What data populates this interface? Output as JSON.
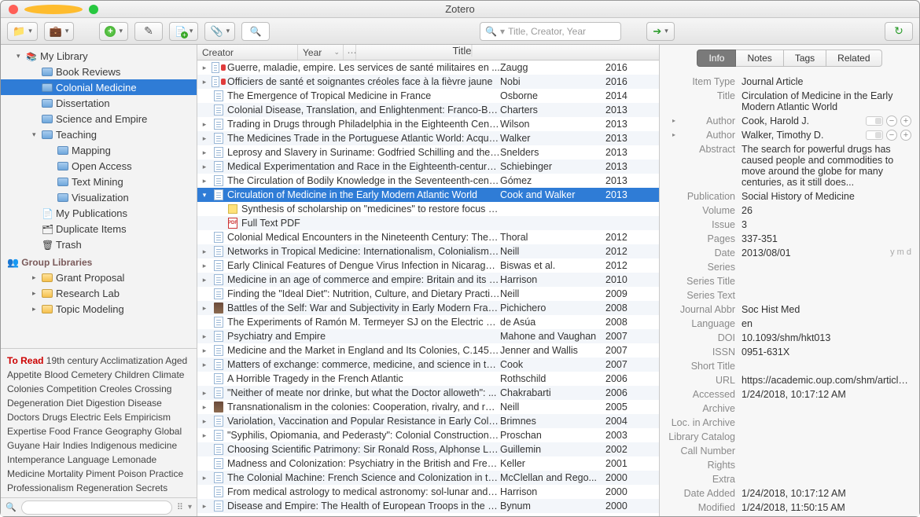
{
  "window": {
    "title": "Zotero"
  },
  "toolbar": {
    "search_placeholder": "Title, Creator, Year"
  },
  "sidebar": {
    "library_label": "My Library",
    "items": [
      {
        "label": "Book Reviews"
      },
      {
        "label": "Colonial Medicine",
        "selected": true
      },
      {
        "label": "Dissertation"
      },
      {
        "label": "Science and Empire"
      },
      {
        "label": "Teaching",
        "expanded": true,
        "children": [
          {
            "label": "Mapping"
          },
          {
            "label": "Open Access"
          },
          {
            "label": "Text Mining"
          },
          {
            "label": "Visualization"
          }
        ]
      }
    ],
    "my_publications": "My Publications",
    "duplicate": "Duplicate Items",
    "trash": "Trash",
    "group_header": "Group Libraries",
    "groups": [
      {
        "label": "Grant Proposal"
      },
      {
        "label": "Research Lab"
      },
      {
        "label": "Topic Modeling"
      }
    ]
  },
  "tags": [
    "To Read",
    "19th century",
    "Acclimatization",
    "Aged",
    "Appetite",
    "Blood",
    "Cemetery",
    "Children",
    "Climate",
    "Colonies",
    "Competition",
    "Creoles",
    "Crossing",
    "Degeneration",
    "Diet",
    "Digestion",
    "Disease",
    "Doctors",
    "Drugs",
    "Electric Eels",
    "Empiricism",
    "Expertise",
    "Food",
    "France",
    "Geography",
    "Global",
    "Guyane",
    "Hair",
    "Indies",
    "Indigenous medicine",
    "Intemperance",
    "Language",
    "Lemonade",
    "Medicine",
    "Mortality",
    "Piment",
    "Poison",
    "Practice",
    "Professionalism",
    "Regeneration",
    "Secrets"
  ],
  "columns": {
    "title": "Title",
    "creator": "Creator",
    "year": "Year"
  },
  "items": [
    {
      "tw": "▸",
      "type": "doc",
      "red": true,
      "title": "Guerre, maladie, empire. Les services de santé militaires en ...",
      "creator": "Zaugg",
      "year": "2016"
    },
    {
      "tw": "▸",
      "type": "doc",
      "red": true,
      "title": "Officiers de santé et soignantes créoles face à la fièvre jaune",
      "creator": "Nobi",
      "year": "2016"
    },
    {
      "tw": "",
      "type": "doc",
      "title": "The Emergence of Tropical Medicine in France",
      "creator": "Osborne",
      "year": "2014"
    },
    {
      "tw": "",
      "type": "doc",
      "title": "Colonial Disease, Translation, and Enlightenment: Franco-Briti...",
      "creator": "Charters",
      "year": "2013"
    },
    {
      "tw": "▸",
      "type": "doc",
      "title": "Trading in Drugs through Philadelphia in the Eighteenth Centu...",
      "creator": "Wilson",
      "year": "2013"
    },
    {
      "tw": "▸",
      "type": "doc",
      "title": "The Medicines Trade in the Portuguese Atlantic World: Acquisi...",
      "creator": "Walker",
      "year": "2013"
    },
    {
      "tw": "▸",
      "type": "doc",
      "title": "Leprosy and Slavery in Suriname: Godfried Schilling and the Fr...",
      "creator": "Snelders",
      "year": "2013"
    },
    {
      "tw": "▸",
      "type": "doc",
      "title": "Medical Experimentation and Race in the Eighteenth-century ...",
      "creator": "Schiebinger",
      "year": "2013"
    },
    {
      "tw": "▸",
      "type": "doc",
      "title": "The Circulation of Bodily Knowledge in the Seventeenth-centu...",
      "creator": "Gómez",
      "year": "2013"
    },
    {
      "tw": "▾",
      "type": "doc",
      "title": "Circulation of Medicine in the Early Modern Atlantic World",
      "creator": "Cook and Walker",
      "year": "2013",
      "selected": true
    },
    {
      "child": true,
      "type": "note",
      "title": "Synthesis of scholarship on \"medicines\" to restore focus o...",
      "creator": "",
      "year": ""
    },
    {
      "child": true,
      "type": "pdf",
      "title": "Full Text PDF",
      "creator": "",
      "year": ""
    },
    {
      "tw": "",
      "type": "doc",
      "title": "Colonial Medical Encounters in the Nineteenth Century: The Fr...",
      "creator": "Thoral",
      "year": "2012"
    },
    {
      "tw": "▸",
      "type": "doc",
      "title": "Networks in Tropical Medicine: Internationalism, Colonialism, a...",
      "creator": "Neill",
      "year": "2012"
    },
    {
      "tw": "▸",
      "type": "doc",
      "title": "Early Clinical Features of Dengue Virus Infection in Nicaraguan...",
      "creator": "Biswas et al.",
      "year": "2012"
    },
    {
      "tw": "▸",
      "type": "doc",
      "title": "Medicine in an age of commerce and empire: Britain and its tr...",
      "creator": "Harrison",
      "year": "2010"
    },
    {
      "tw": "",
      "type": "doc",
      "title": "Finding the \"Ideal Diet\": Nutrition, Culture, and Dietary Practic...",
      "creator": "Neill",
      "year": "2009"
    },
    {
      "tw": "▸",
      "type": "book",
      "title": "Battles of the Self: War and Subjectivity in Early Modern France",
      "creator": "Pichichero",
      "year": "2008"
    },
    {
      "tw": "",
      "type": "doc",
      "title": "The Experiments of Ramón M. Termeyer SJ on the Electric Eel ...",
      "creator": "de Asúa",
      "year": "2008"
    },
    {
      "tw": "▸",
      "type": "doc",
      "title": "Psychiatry and Empire",
      "creator": "Mahone and Vaughan",
      "year": "2007"
    },
    {
      "tw": "▸",
      "type": "doc",
      "title": "Medicine and the Market in England and Its Colonies, C.1450-...",
      "creator": "Jenner and Wallis",
      "year": "2007"
    },
    {
      "tw": "▸",
      "type": "doc",
      "title": "Matters of exchange: commerce, medicine, and science in the...",
      "creator": "Cook",
      "year": "2007"
    },
    {
      "tw": "",
      "type": "doc",
      "title": "A Horrible Tragedy in the French Atlantic",
      "creator": "Rothschild",
      "year": "2006"
    },
    {
      "tw": "▸",
      "type": "doc",
      "title": "\"Neither of meate nor drinke, but what the Doctor alloweth\": ...",
      "creator": "Chakrabarti",
      "year": "2006"
    },
    {
      "tw": "▸",
      "type": "book",
      "title": "Transnationalism in the colonies: Cooperation, rivalry, and rac...",
      "creator": "Neill",
      "year": "2005"
    },
    {
      "tw": "▸",
      "type": "doc",
      "title": "Variolation, Vaccination and Popular Resistance in Early Coloni...",
      "creator": "Brimnes",
      "year": "2004"
    },
    {
      "tw": "▸",
      "type": "doc",
      "title": "\"Syphilis, Opiomania, and Pederasty\": Colonial Constructions ...",
      "creator": "Proschan",
      "year": "2003"
    },
    {
      "tw": "",
      "type": "doc",
      "title": "Choosing Scientific Patrimony: Sir Ronald Ross, Alphonse Lav...",
      "creator": "Guillemin",
      "year": "2002"
    },
    {
      "tw": "",
      "type": "doc",
      "title": "Madness and Colonization: Psychiatry in the British and Frenc...",
      "creator": "Keller",
      "year": "2001"
    },
    {
      "tw": "▸",
      "type": "doc",
      "title": "The Colonial Machine: French Science and Colonization in the ...",
      "creator": "McClellan and Rego...",
      "year": "2000"
    },
    {
      "tw": "",
      "type": "doc",
      "title": "From medical astrology to medical astronomy: sol-lunar and pl...",
      "creator": "Harrison",
      "year": "2000"
    },
    {
      "tw": "▸",
      "type": "doc",
      "title": "Disease and Empire: The Health of European Troops in the Co...",
      "creator": "Bynum",
      "year": "2000"
    }
  ],
  "pane": {
    "tabs": [
      "Info",
      "Notes",
      "Tags",
      "Related"
    ],
    "fields": {
      "item_type_label": "Item Type",
      "item_type": "Journal Article",
      "title_label": "Title",
      "title": "Circulation of Medicine in the Early Modern Atlantic World",
      "author_label": "Author",
      "author1": "Cook, Harold J.",
      "author2": "Walker, Timothy D.",
      "abstract_label": "Abstract",
      "abstract": "The search for powerful drugs has caused people and commodities to move around the globe for many centuries, as it still does...",
      "publication_label": "Publication",
      "publication": "Social History of Medicine",
      "volume_label": "Volume",
      "volume": "26",
      "issue_label": "Issue",
      "issue": "3",
      "pages_label": "Pages",
      "pages": "337-351",
      "date_label": "Date",
      "date": "2013/08/01",
      "date_hint": "y m d",
      "series_label": "Series",
      "series_title_label": "Series Title",
      "series_text_label": "Series Text",
      "journal_abbr_label": "Journal Abbr",
      "journal_abbr": "Soc Hist Med",
      "language_label": "Language",
      "language": "en",
      "doi_label": "DOI",
      "doi": "10.1093/shm/hkt013",
      "issn_label": "ISSN",
      "issn": "0951-631X",
      "short_title_label": "Short Title",
      "url_label": "URL",
      "url": "https://academic.oup.com/shm/article/26/3...",
      "accessed_label": "Accessed",
      "accessed": "1/24/2018, 10:17:12 AM",
      "archive_label": "Archive",
      "loc_archive_label": "Loc. in Archive",
      "catalog_label": "Library Catalog",
      "call_label": "Call Number",
      "rights_label": "Rights",
      "extra_label": "Extra",
      "date_added_label": "Date Added",
      "date_added": "1/24/2018, 10:17:12 AM",
      "modified_label": "Modified",
      "modified": "1/24/2018, 11:50:15 AM"
    }
  }
}
